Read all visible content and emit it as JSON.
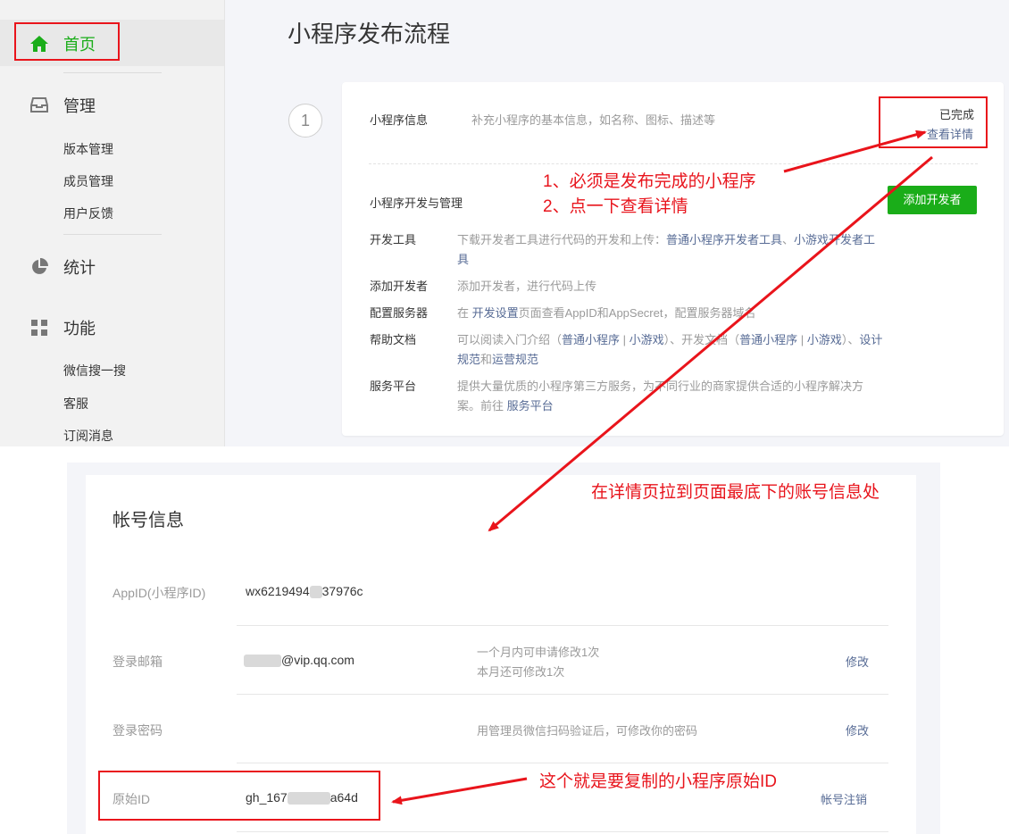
{
  "sidebar": {
    "home_label": "首页",
    "sections": [
      {
        "label": "管理",
        "icon": "inbox-icon",
        "items": [
          "版本管理",
          "成员管理",
          "用户反馈"
        ]
      },
      {
        "label": "统计",
        "icon": "pie-chart-icon"
      },
      {
        "label": "功能",
        "icon": "grid-icon",
        "items": [
          "微信搜一搜",
          "客服",
          "订阅消息"
        ]
      }
    ]
  },
  "page": {
    "title": "小程序发布流程",
    "step_number": "1"
  },
  "info_row": {
    "title": "小程序信息",
    "desc": "补充小程序的基本信息，如名称、图标、描述等",
    "status": "已完成",
    "detail_link": "查看详情"
  },
  "dev": {
    "title": "小程序开发与管理",
    "add_button": "添加开发者",
    "tools": {
      "label": "开发工具",
      "text_a": "下载开发者工具进行代码的开发和上传：",
      "link_a": "普通小程序开发者工具",
      "text_b": "、",
      "link_b": "小游戏开发者工具"
    },
    "add_dev": {
      "label": "添加开发者",
      "text": "添加开发者，进行代码上传"
    },
    "server": {
      "label": "配置服务器",
      "text_a": "在 ",
      "link": "开发设置",
      "text_b": "页面查看AppID和AppSecret，配置服务器域名"
    },
    "help": {
      "label": "帮助文档",
      "t1": "可以阅读入门介绍（",
      "l1": "普通小程序",
      "s1": " | ",
      "l2": "小游戏",
      "t2": "）、开发文档（",
      "l3": "普通小程序",
      "s2": " | ",
      "l4": "小游戏",
      "t3": "）、",
      "l5": "设计规范",
      "t4": "和",
      "l6": "运营规范"
    },
    "platform": {
      "label": "服务平台",
      "text": "提供大量优质的小程序第三方服务，为不同行业的商家提供合适的小程序解决方案。前往 ",
      "link": "服务平台"
    }
  },
  "account": {
    "title": "帐号信息",
    "appid": {
      "label": "AppID(小程序ID)",
      "value_a": "wx6219494",
      "value_b": "37976c"
    },
    "email": {
      "label": "登录邮箱",
      "value": "@vip.qq.com",
      "tip1": "一个月内可申请修改1次",
      "tip2": "本月还可修改1次",
      "action": "修改"
    },
    "password": {
      "label": "登录密码",
      "tip": "用管理员微信扫码验证后，可修改你的密码",
      "action": "修改"
    },
    "origin_id": {
      "label": "原始ID",
      "value_a": "gh_167",
      "value_b": "a64d",
      "action": "帐号注销"
    }
  },
  "annotations": {
    "note1": "1、必须是发布完成的小程序",
    "note2": "2、点一下查看详情",
    "note3": "在详情页拉到页面最底下的账号信息处",
    "note4": "这个就是要复制的小程序原始ID",
    "color": "#e9141b"
  },
  "colors": {
    "accent_green": "#1aad19",
    "link": "#576b95",
    "sidebar_bg": "#f2f2f2",
    "main_bg": "#f4f5f9"
  }
}
